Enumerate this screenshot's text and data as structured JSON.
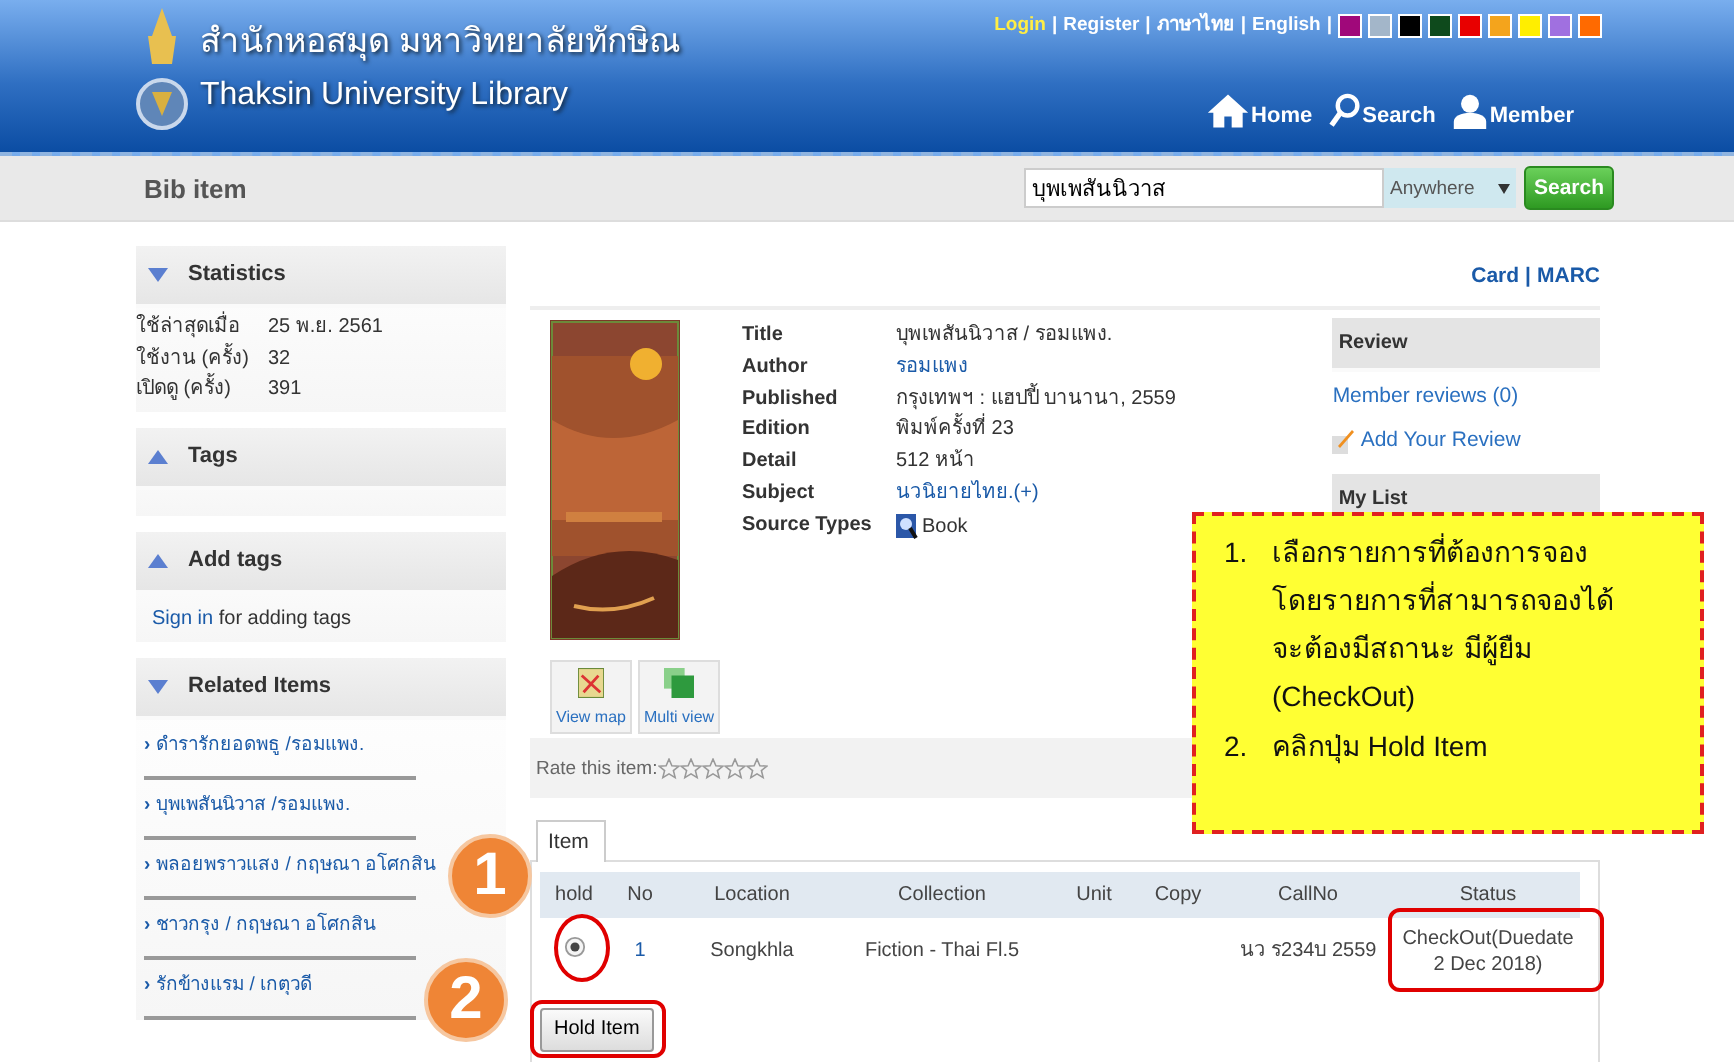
{
  "header": {
    "title_thai": "สำนักหอสมุด มหาวิทยาลัยทักษิณ",
    "title_english": "Thaksin University Library",
    "separator": "|",
    "top_links": [
      {
        "label": "Login",
        "selected": true
      },
      {
        "label": "Register",
        "selected": false
      },
      {
        "label": "ภาษาไทย",
        "selected": false
      },
      {
        "label": "English",
        "selected": false
      }
    ],
    "theme_colors": [
      {
        "color": "#a0087a"
      },
      {
        "color": "#a3b6c9"
      },
      {
        "color": "#000000"
      },
      {
        "color": "#0e4a1c"
      },
      {
        "color": "#e80000"
      },
      {
        "color": "#f4a41c"
      },
      {
        "color": "#ffee00"
      },
      {
        "color": "#a070e0"
      },
      {
        "color": "#ff6a00"
      }
    ],
    "nav": [
      {
        "label": "Home",
        "kind": "home"
      },
      {
        "label": "Search",
        "kind": "search"
      },
      {
        "label": "Member",
        "kind": "member"
      }
    ]
  },
  "page_title": "Bib item",
  "search": {
    "value": "บุพเพสันนิวาส",
    "scope": "Anywhere",
    "button": "Search"
  },
  "sidebar": {
    "sections": [
      {
        "title": "Statistics",
        "expanded": true,
        "rows": [
          {
            "label": "ใช้ล่าสุดเมื่อ",
            "value": "25 พ.ย. 2561"
          },
          {
            "label": "ใช้งาน (ครั้ง)",
            "value": "32"
          },
          {
            "label": "เปิดดู (ครั้ง)",
            "value": "391"
          }
        ]
      },
      {
        "title": "Tags",
        "expanded": false
      },
      {
        "title": "Add tags",
        "expanded": false,
        "link": "Sign in",
        "text": "for adding tags"
      },
      {
        "title": "Related Items",
        "expanded": true,
        "bullet": "›",
        "links": [
          "ดำรารักยอดพธู /รอมแพง.",
          "บุพเพสันนิวาส /รอมแพง.",
          "พลอยพราวแสง / กฤษณา อโศกสิน",
          "ชาวกรุง / กฤษณา อโศกสิน",
          "รักข้างแรม / เกตุวดี"
        ]
      }
    ]
  },
  "record": {
    "links": [
      "Card",
      "MARC"
    ],
    "separator": "|",
    "fields": [
      {
        "label": "Title",
        "value": "บุพเพสันนิวาส / รอมแพง.",
        "kind": "text"
      },
      {
        "label": "Author",
        "value": "รอมแพง",
        "kind": "link"
      },
      {
        "label": "Published",
        "value": "กรุงเทพฯ : แฮปปี้ บานานา, 2559",
        "kind": "text"
      },
      {
        "label": "Edition",
        "value": "พิมพ์ครั้งที่ 23",
        "kind": "text"
      },
      {
        "label": "Detail",
        "value": "512 หน้า",
        "kind": "text"
      },
      {
        "label": "Subject",
        "value": "นวนิยายไทย.(+)",
        "kind": "link"
      },
      {
        "label": "Source Types",
        "value": "Book",
        "kind": "icon"
      }
    ],
    "cover_buttons": [
      {
        "label": "View map",
        "kind": "map"
      },
      {
        "label": "Multi view",
        "kind": "multi"
      }
    ],
    "rate_label": "Rate this item:",
    "stars": 0
  },
  "review": {
    "title": "Review",
    "member_reviews": "Member reviews (0)",
    "add_review": "Add Your Review"
  },
  "my_list": {
    "title": "My List"
  },
  "items_tab": {
    "label": "Item",
    "selected": true
  },
  "table": {
    "columns": [
      "hold",
      "No",
      "Location",
      "Collection",
      "Unit",
      "Copy",
      "CallNo",
      "Status"
    ],
    "rows": [
      {
        "selected": true,
        "no": "1",
        "location": "Songkhla",
        "collection": "Fiction - Thai Fl.5",
        "callno": "นว ร234บ 2559",
        "status": "CheckOut(Duedate 2 Dec 2018)"
      }
    ]
  },
  "hold_button": "Hold Item",
  "callout": {
    "steps": [
      {
        "number": "1.",
        "text": "เลือกรายการที่ต้องการจอง\nโดยรายการที่สามารถจองได้\nจะต้องมีสถานะ มีผู้ยืม\n(CheckOut)"
      },
      {
        "number": "2.",
        "text": "คลิกปุ่ม Hold Item"
      }
    ]
  },
  "markers": [
    "1",
    "2"
  ]
}
